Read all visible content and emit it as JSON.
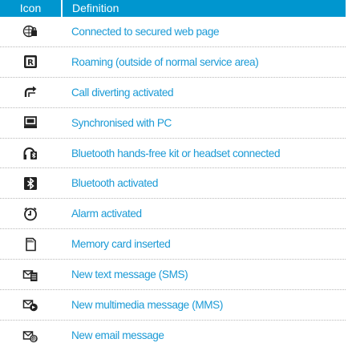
{
  "table": {
    "header": {
      "icon_col": "Icon",
      "definition_col": "Definition"
    },
    "rows": [
      {
        "icon": "secured-web-icon",
        "definition": "Connected to secured web page"
      },
      {
        "icon": "roaming-icon",
        "definition": "Roaming (outside of normal service area)"
      },
      {
        "icon": "call-divert-icon",
        "definition": "Call diverting activated"
      },
      {
        "icon": "pc-sync-icon",
        "definition": "Synchronised with PC"
      },
      {
        "icon": "bluetooth-headset-icon",
        "definition": "Bluetooth hands-free kit or headset connected"
      },
      {
        "icon": "bluetooth-icon",
        "definition": "Bluetooth activated"
      },
      {
        "icon": "alarm-icon",
        "definition": "Alarm activated"
      },
      {
        "icon": "memory-card-icon",
        "definition": "Memory card inserted"
      },
      {
        "icon": "sms-icon",
        "definition": "New text message (SMS)"
      },
      {
        "icon": "mms-icon",
        "definition": "New multimedia message (MMS)"
      },
      {
        "icon": "email-icon",
        "definition": "New email message"
      }
    ]
  }
}
